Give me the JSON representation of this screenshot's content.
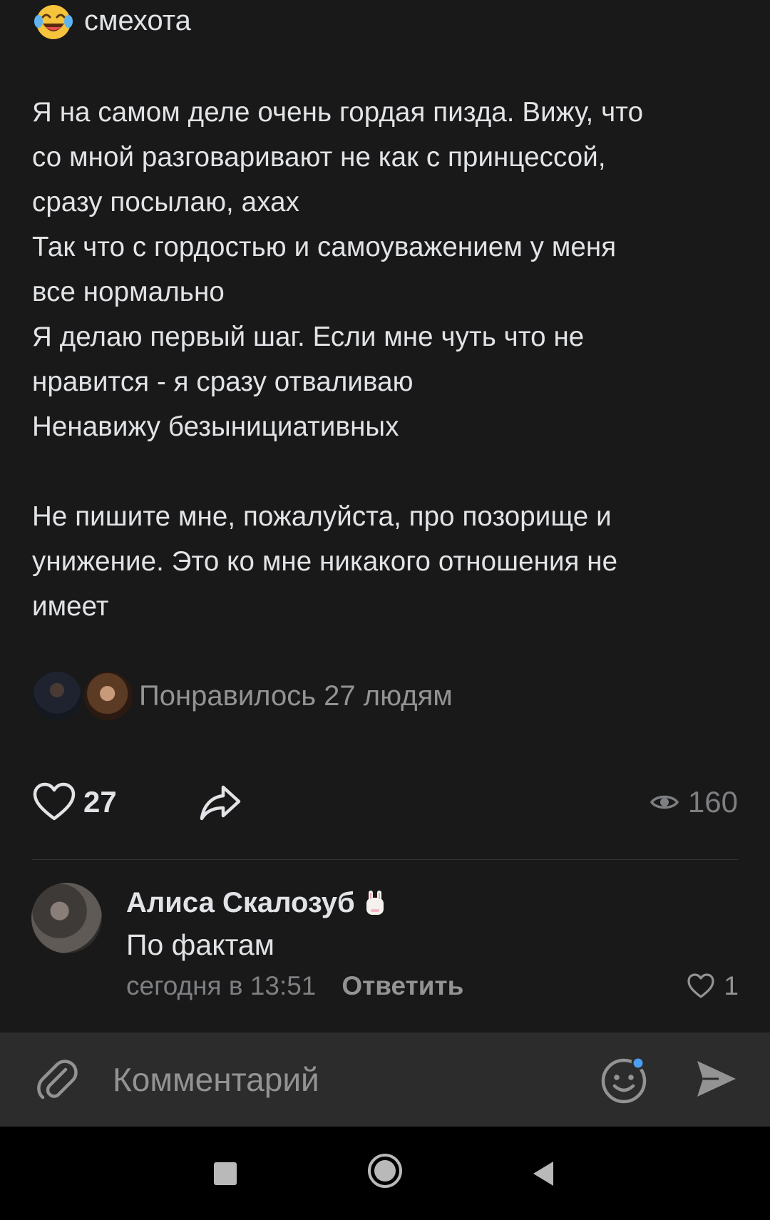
{
  "reaction": {
    "icon": "laughing-tears-emoji",
    "label": "смехота"
  },
  "post": {
    "text": "Я на самом деле очень гордая пизда. Вижу, что\nсо мной разговаривают не как с принцессой,\nсразу посылаю, ахах\nТак что с гордостью и самоуважением у меня\nвсе нормально\nЯ делаю первый шаг. Если мне чуть что не\nнравится - я сразу отваливаю\nНенавижу безынициативных\n\nНе пишите мне, пожалуйста, про позорище и\nунижение. Это ко мне никакого отношения не\nимеет"
  },
  "likes_summary": {
    "text": "Понравилось 27 людям"
  },
  "actions": {
    "like_count": "27",
    "views_count": "160"
  },
  "comment": {
    "author": "Алиса Скалозуб",
    "text": "По фактам",
    "time": "сегодня в 13:51",
    "reply_label": "Ответить",
    "like_count": "1"
  },
  "compose": {
    "placeholder": "Комментарий"
  },
  "colors": {
    "background": "#191919",
    "text_primary": "#e1e3e6",
    "text_secondary": "#939393",
    "compose_bar": "#2c2c2c",
    "accent_blue": "#4b9ef0"
  }
}
